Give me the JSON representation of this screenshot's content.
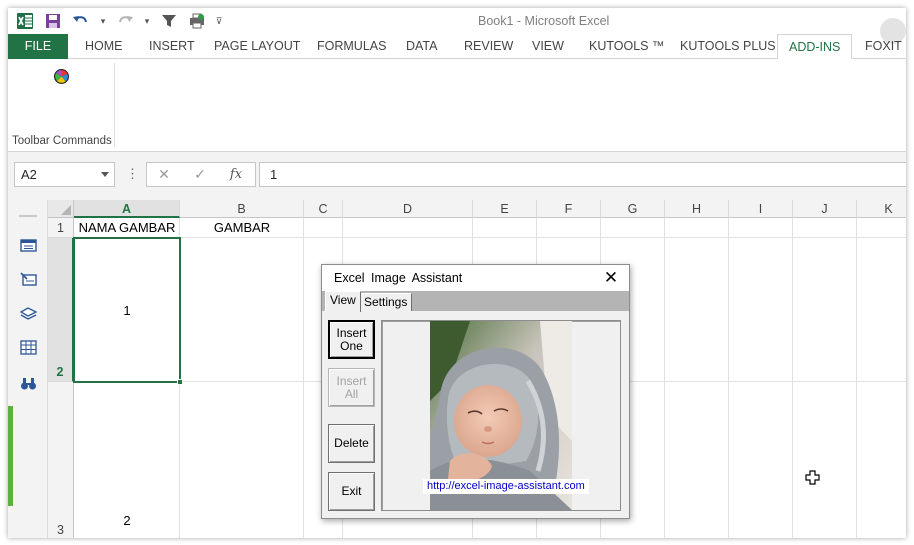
{
  "window": {
    "title": "Book1 - Microsoft Excel"
  },
  "qat": {
    "dropdown_glyph": "▾",
    "customize_glyph": "⊽"
  },
  "tabs": [
    {
      "label": "FILE"
    },
    {
      "label": "HOME"
    },
    {
      "label": "INSERT"
    },
    {
      "label": "PAGE LAYOUT"
    },
    {
      "label": "FORMULAS"
    },
    {
      "label": "DATA"
    },
    {
      "label": "REVIEW"
    },
    {
      "label": "VIEW"
    },
    {
      "label": "KUTOOLS ™"
    },
    {
      "label": "KUTOOLS PLUS"
    },
    {
      "label": "ADD-INS"
    },
    {
      "label": "FOXIT P"
    }
  ],
  "active_tab": "ADD-INS",
  "ribbon": {
    "group_label": "Toolbar Commands"
  },
  "formula_bar": {
    "name_box": "A2",
    "dots": "⋮",
    "cancel_glyph": "✕",
    "enter_glyph": "✓",
    "fx_glyph": "fx",
    "value": "1"
  },
  "sheet": {
    "columns": [
      "A",
      "B",
      "C",
      "D",
      "E",
      "F",
      "G",
      "H",
      "I",
      "J",
      "K"
    ],
    "rows": [
      "1",
      "2",
      "3"
    ],
    "cells": {
      "A1": "NAMA GAMBAR",
      "B1": "GAMBAR",
      "A2": "1",
      "A3": "2"
    },
    "selected_cell": "A2"
  },
  "dialog": {
    "title": "Excel  Image  Assistant",
    "close_glyph": "✕",
    "tabs": [
      {
        "label": "View"
      },
      {
        "label": "Settings"
      }
    ],
    "buttons": {
      "insert_one": [
        "Insert",
        "One"
      ],
      "insert_all": [
        "Insert",
        "All"
      ],
      "delete": "Delete",
      "exit": "Exit"
    },
    "url": "http://excel-image-assistant.com"
  },
  "colors": {
    "excel_green": "#217346",
    "accent_strip": "#5fb03b",
    "link_blue": "#0000c8"
  }
}
